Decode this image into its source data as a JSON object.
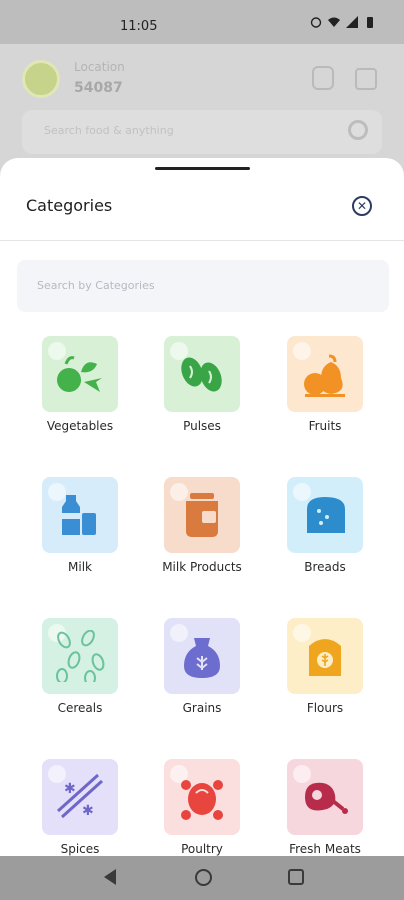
{
  "status": {
    "time": "11:05"
  },
  "background": {
    "location_label": "Location",
    "location_code": "54087",
    "search_placeholder": "Search food & anything"
  },
  "sheet": {
    "title": "Categories",
    "search_placeholder": "Search by Categories"
  },
  "categories": [
    {
      "label": "Vegetables",
      "icon": "vegetables-icon",
      "bg": "#d8f1d6",
      "fg": "#43b24a"
    },
    {
      "label": "Pulses",
      "icon": "pulses-icon",
      "bg": "#d8f1d6",
      "fg": "#3aa547"
    },
    {
      "label": "Fruits",
      "icon": "fruits-icon",
      "bg": "#fde7cf",
      "fg": "#f39224"
    },
    {
      "label": "Milk",
      "icon": "milk-icon",
      "bg": "#d6ecfb",
      "fg": "#3a8fd4"
    },
    {
      "label": "Milk Products",
      "icon": "milk-products-icon",
      "bg": "#f7dccb",
      "fg": "#d97b3e"
    },
    {
      "label": "Breads",
      "icon": "bread-icon",
      "bg": "#d3eefb",
      "fg": "#2d8ccc"
    },
    {
      "label": "Cereals",
      "icon": "cereals-icon",
      "bg": "#d5f1e3",
      "fg": "#6bc39a"
    },
    {
      "label": "Grains",
      "icon": "grains-icon",
      "bg": "#e1e1f7",
      "fg": "#6d6ccf"
    },
    {
      "label": "Flours",
      "icon": "flours-icon",
      "bg": "#fdeec7",
      "fg": "#f0a51f"
    },
    {
      "label": "Spices",
      "icon": "spices-icon",
      "bg": "#e4e0f9",
      "fg": "#6e66c9"
    },
    {
      "label": "Poultry",
      "icon": "poultry-icon",
      "bg": "#fbdede",
      "fg": "#e8453f"
    },
    {
      "label": "Fresh Meats",
      "icon": "meat-icon",
      "bg": "#f7d7de",
      "fg": "#b72b4b"
    }
  ]
}
